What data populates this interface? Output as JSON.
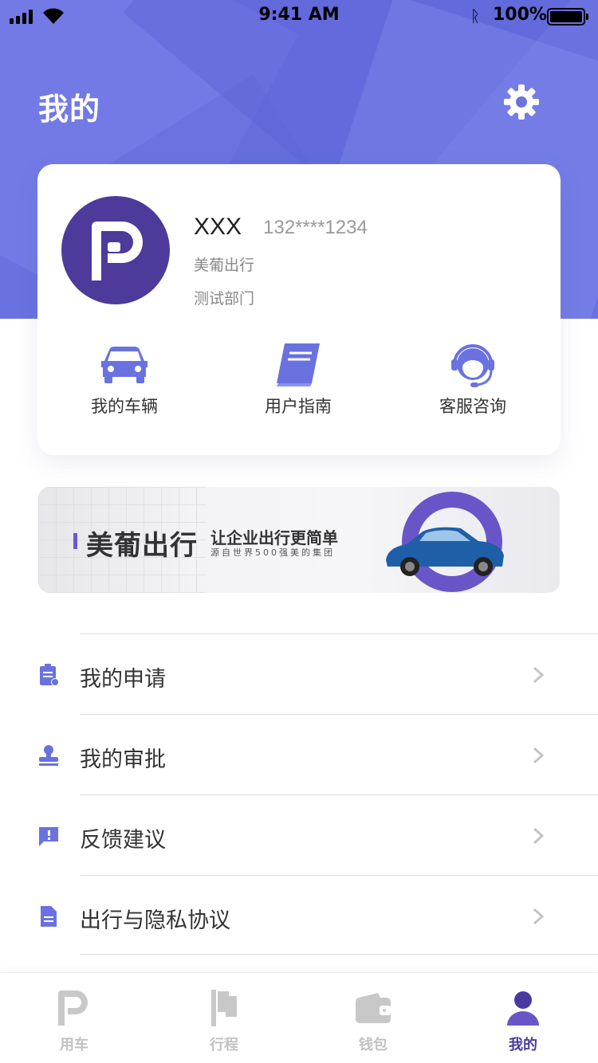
{
  "status_bar": {
    "time": "9:41 AM",
    "battery_percent": "100%"
  },
  "header": {
    "title": "我的",
    "settings_icon": "gear-icon"
  },
  "profile": {
    "name": "XXX",
    "phone": "132****1234",
    "company": "美葡出行",
    "department": "测试部门"
  },
  "quick_actions": [
    {
      "label": "我的车辆",
      "icon": "car-icon"
    },
    {
      "label": "用户指南",
      "icon": "book-icon"
    },
    {
      "label": "客服咨询",
      "icon": "headset-icon"
    }
  ],
  "banner": {
    "brand": "美葡出行",
    "slogan": "让企业出行更简单",
    "subtitle": "源自世界500强美的集团"
  },
  "menu": [
    {
      "label": "我的申请",
      "icon": "clipboard-icon"
    },
    {
      "label": "我的审批",
      "icon": "stamp-icon"
    },
    {
      "label": "反馈建议",
      "icon": "feedback-icon"
    },
    {
      "label": "出行与隐私协议",
      "icon": "document-icon"
    }
  ],
  "tabs": [
    {
      "label": "用车",
      "icon": "p-logo-icon",
      "active": false
    },
    {
      "label": "行程",
      "icon": "flag-icon",
      "active": false
    },
    {
      "label": "钱包",
      "icon": "wallet-icon",
      "active": false
    },
    {
      "label": "我的",
      "icon": "person-icon",
      "active": true
    }
  ],
  "colors": {
    "accent": "#6a72e0",
    "brand_dark": "#4a3aa0",
    "inactive_tab": "#c2c2c2"
  }
}
